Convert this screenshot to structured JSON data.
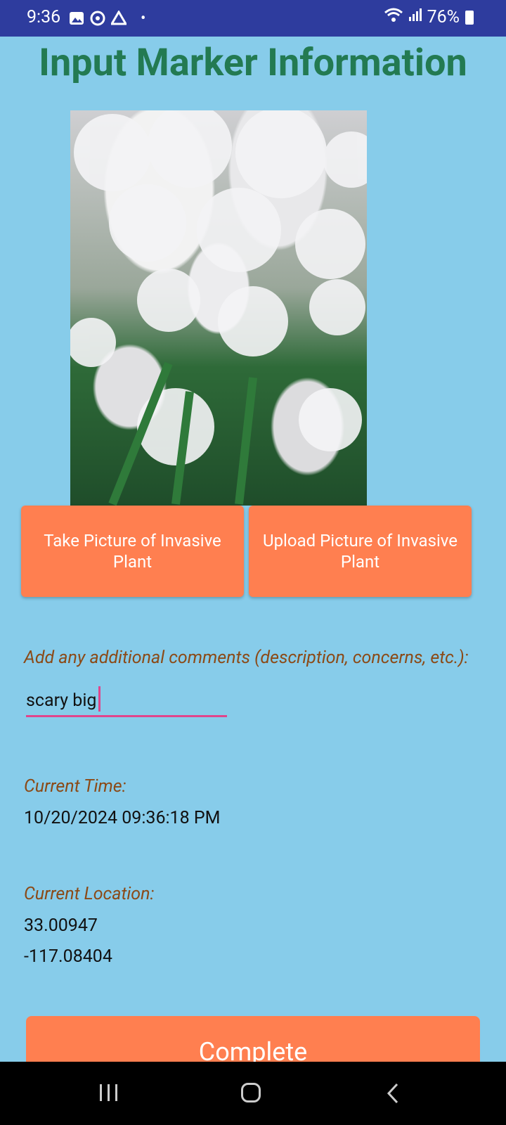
{
  "status_bar": {
    "time": "9:36",
    "battery": "76%",
    "icons_left": [
      "gallery-icon",
      "sync-icon",
      "drive-icon",
      "dot-icon"
    ],
    "icons_right": [
      "wifi-icon",
      "signal-icon",
      "battery-icon"
    ]
  },
  "page": {
    "title": "Input Marker Information"
  },
  "photo": {
    "subject": "white-flowered invasive plant photo"
  },
  "buttons": {
    "take_picture": "Take Picture of Invasive Plant",
    "upload_picture": "Upload Picture of Invasive Plant",
    "complete": "Complete"
  },
  "comments": {
    "label": "Add any additional comments (description, concerns, etc.):",
    "value": "scary big"
  },
  "time": {
    "label": "Current Time:",
    "value": "10/20/2024 09:36:18 PM"
  },
  "location": {
    "label": "Current Location:",
    "latitude": "33.00947",
    "longitude": "-117.08404"
  },
  "colors": {
    "background": "#87CCEA",
    "status_bar": "#2E3C9E",
    "title": "#237A52",
    "button": "#FF7F50",
    "label": "#8B4A17",
    "input_underline": "#E0458C"
  }
}
